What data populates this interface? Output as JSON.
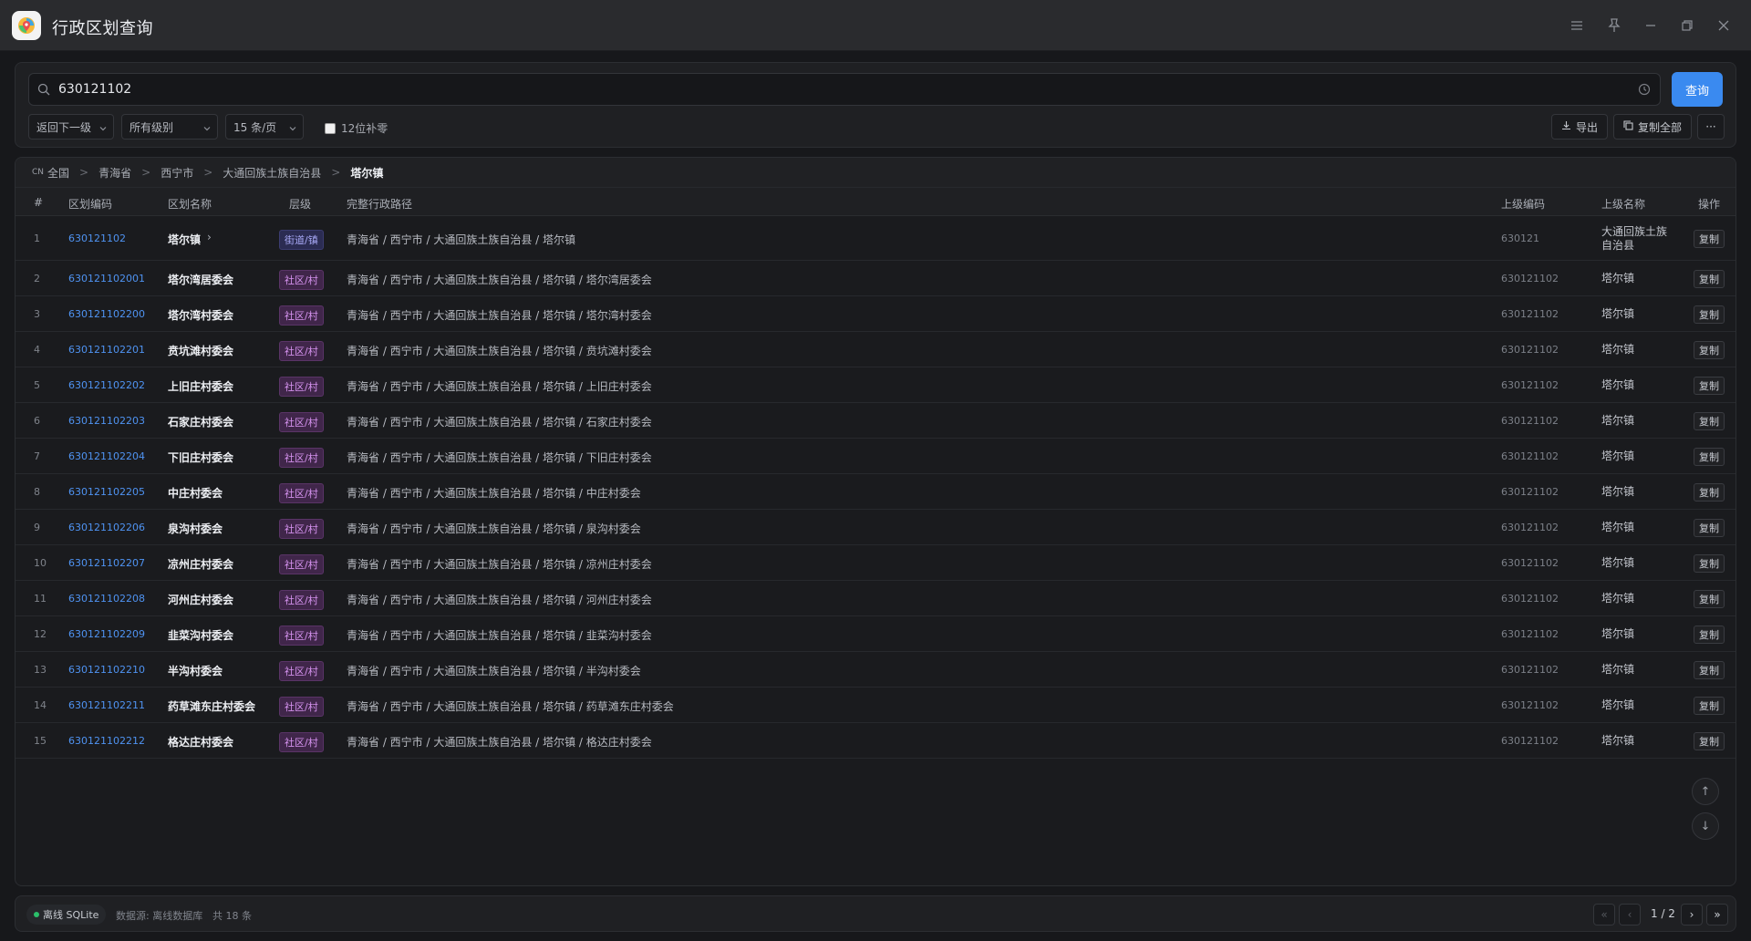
{
  "app": {
    "title": "行政区划查询"
  },
  "search": {
    "value": "630121102",
    "button_label": "查询"
  },
  "filters": {
    "back_label": "返回下一级",
    "level_label": "所有级别",
    "page_size_label": "15 条/页",
    "pad_checkbox_label": "12位补零",
    "export_label": "导出",
    "copy_all_label": "复制全部",
    "more_label": "···"
  },
  "breadcrumb": {
    "cn_badge": "CN",
    "items": [
      "全国",
      "青海省",
      "西宁市",
      "大通回族土族自治县",
      "塔尔镇"
    ]
  },
  "table": {
    "headers": {
      "idx": "#",
      "code": "区划编码",
      "name": "区划名称",
      "level": "层级",
      "path": "完整行政路径",
      "parent_code": "上级编码",
      "parent_name": "上级名称",
      "op": "操作"
    },
    "copy_label": "复制",
    "rows": [
      {
        "idx": "1",
        "code": "630121102",
        "name": "塔尔镇",
        "level": "街道/镇",
        "path": "青海省 / 西宁市 / 大通回族土族自治县 / 塔尔镇",
        "parent_code": "630121",
        "parent_name": "大通回族土族自治县"
      },
      {
        "idx": "2",
        "code": "630121102001",
        "name": "塔尔湾居委会",
        "level": "社区/村",
        "path": "青海省 / 西宁市 / 大通回族土族自治县 / 塔尔镇 / 塔尔湾居委会",
        "parent_code": "630121102",
        "parent_name": "塔尔镇"
      },
      {
        "idx": "3",
        "code": "630121102200",
        "name": "塔尔湾村委会",
        "level": "社区/村",
        "path": "青海省 / 西宁市 / 大通回族土族自治县 / 塔尔镇 / 塔尔湾村委会",
        "parent_code": "630121102",
        "parent_name": "塔尔镇"
      },
      {
        "idx": "4",
        "code": "630121102201",
        "name": "贲坑滩村委会",
        "level": "社区/村",
        "path": "青海省 / 西宁市 / 大通回族土族自治县 / 塔尔镇 / 贲坑滩村委会",
        "parent_code": "630121102",
        "parent_name": "塔尔镇"
      },
      {
        "idx": "5",
        "code": "630121102202",
        "name": "上旧庄村委会",
        "level": "社区/村",
        "path": "青海省 / 西宁市 / 大通回族土族自治县 / 塔尔镇 / 上旧庄村委会",
        "parent_code": "630121102",
        "parent_name": "塔尔镇"
      },
      {
        "idx": "6",
        "code": "630121102203",
        "name": "石家庄村委会",
        "level": "社区/村",
        "path": "青海省 / 西宁市 / 大通回族土族自治县 / 塔尔镇 / 石家庄村委会",
        "parent_code": "630121102",
        "parent_name": "塔尔镇"
      },
      {
        "idx": "7",
        "code": "630121102204",
        "name": "下旧庄村委会",
        "level": "社区/村",
        "path": "青海省 / 西宁市 / 大通回族土族自治县 / 塔尔镇 / 下旧庄村委会",
        "parent_code": "630121102",
        "parent_name": "塔尔镇"
      },
      {
        "idx": "8",
        "code": "630121102205",
        "name": "中庄村委会",
        "level": "社区/村",
        "path": "青海省 / 西宁市 / 大通回族土族自治县 / 塔尔镇 / 中庄村委会",
        "parent_code": "630121102",
        "parent_name": "塔尔镇"
      },
      {
        "idx": "9",
        "code": "630121102206",
        "name": "泉沟村委会",
        "level": "社区/村",
        "path": "青海省 / 西宁市 / 大通回族土族自治县 / 塔尔镇 / 泉沟村委会",
        "parent_code": "630121102",
        "parent_name": "塔尔镇"
      },
      {
        "idx": "10",
        "code": "630121102207",
        "name": "凉州庄村委会",
        "level": "社区/村",
        "path": "青海省 / 西宁市 / 大通回族土族自治县 / 塔尔镇 / 凉州庄村委会",
        "parent_code": "630121102",
        "parent_name": "塔尔镇"
      },
      {
        "idx": "11",
        "code": "630121102208",
        "name": "河州庄村委会",
        "level": "社区/村",
        "path": "青海省 / 西宁市 / 大通回族土族自治县 / 塔尔镇 / 河州庄村委会",
        "parent_code": "630121102",
        "parent_name": "塔尔镇"
      },
      {
        "idx": "12",
        "code": "630121102209",
        "name": "韭菜沟村委会",
        "level": "社区/村",
        "path": "青海省 / 西宁市 / 大通回族土族自治县 / 塔尔镇 / 韭菜沟村委会",
        "parent_code": "630121102",
        "parent_name": "塔尔镇"
      },
      {
        "idx": "13",
        "code": "630121102210",
        "name": "半沟村委会",
        "level": "社区/村",
        "path": "青海省 / 西宁市 / 大通回族土族自治县 / 塔尔镇 / 半沟村委会",
        "parent_code": "630121102",
        "parent_name": "塔尔镇"
      },
      {
        "idx": "14",
        "code": "630121102211",
        "name": "药草滩东庄村委会",
        "level": "社区/村",
        "path": "青海省 / 西宁市 / 大通回族土族自治县 / 塔尔镇 / 药草滩东庄村委会",
        "parent_code": "630121102",
        "parent_name": "塔尔镇"
      },
      {
        "idx": "15",
        "code": "630121102212",
        "name": "格达庄村委会",
        "level": "社区/村",
        "path": "青海省 / 西宁市 / 大通回族土族自治县 / 塔尔镇 / 格达庄村委会",
        "parent_code": "630121102",
        "parent_name": "塔尔镇"
      }
    ]
  },
  "status": {
    "db_label": "离线 SQLite",
    "source_label": "数据源: 离线数据库",
    "count_label": "共 18 条",
    "page_label": "1 / 2"
  },
  "colors": {
    "accent": "#3a8af0",
    "status_ok": "#2bbf6a",
    "level_village": "#d693f0",
    "level_town": "#a7a8f5"
  }
}
